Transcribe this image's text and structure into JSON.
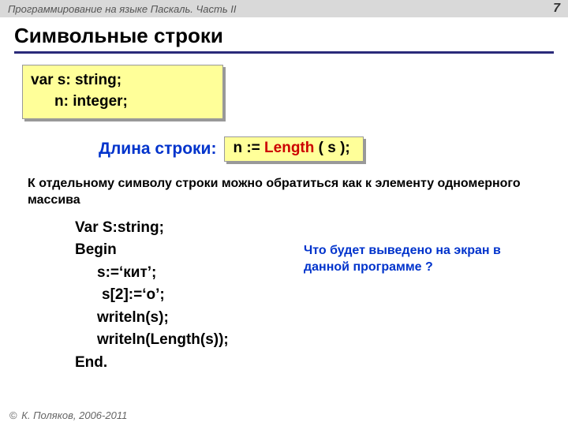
{
  "header": {
    "course_title": "Программирование на языке Паскаль. Часть II",
    "page_number": "7"
  },
  "title": "Символьные строки",
  "var_box": {
    "line1": "var s: string;",
    "line2": "n: integer;"
  },
  "length_section": {
    "label": "Длина строки:",
    "prefix": "n := ",
    "func": "Length",
    "suffix": " ( s );"
  },
  "paragraph": "К отдельному символу строки можно обратиться как к элементу одномерного массива",
  "code": {
    "l1": "Var S:string;",
    "l2": "Begin",
    "l3": "s:=‘кит’;",
    "l4": "s[2]:=‘о’;",
    "l5": "writeln(s);",
    "l6": "writeln(Length(s));",
    "l7": "End."
  },
  "question": "Что будет выведено на экран в данной программе ?",
  "footer": {
    "copyright_symbol": "©",
    "text": " К. Поляков, 2006-2011"
  }
}
